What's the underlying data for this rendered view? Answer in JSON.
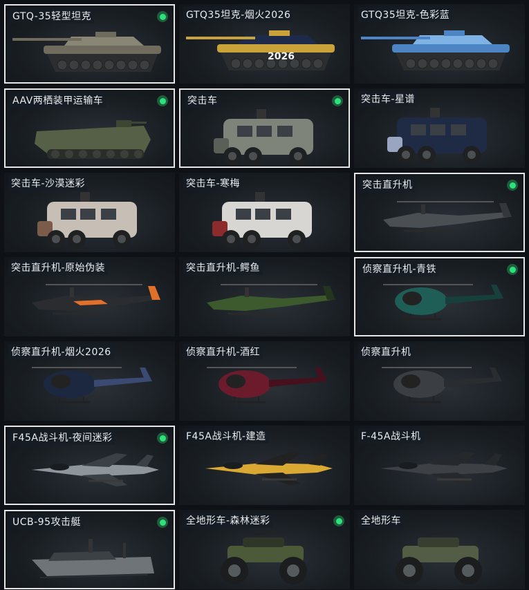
{
  "items": [
    {
      "label": "GTQ-35轻型坦克",
      "owned": true,
      "selected": true,
      "icon": "tank-icon",
      "colors": [
        "#8a8675",
        "#6f6c5e"
      ]
    },
    {
      "label": "GTQ35坦克-烟火2026",
      "owned": false,
      "selected": false,
      "icon": "tank-icon",
      "colors": [
        "#1d2a4a",
        "#c9a23a"
      ],
      "decal": "2026"
    },
    {
      "label": "GTQ35坦克-色彩蓝",
      "owned": false,
      "selected": false,
      "icon": "tank-icon",
      "colors": [
        "#7fb3e6",
        "#4d85c4"
      ]
    },
    {
      "label": "AAV两栖装甲运输车",
      "owned": true,
      "selected": true,
      "icon": "amphibious-vehicle-icon",
      "colors": [
        "#556046",
        "#3d4633"
      ]
    },
    {
      "label": "突击车",
      "owned": true,
      "selected": true,
      "icon": "armored-truck-icon",
      "colors": [
        "#7e847a",
        "#5a6057"
      ]
    },
    {
      "label": "突击车-星谱",
      "owned": false,
      "selected": false,
      "icon": "armored-truck-icon",
      "colors": [
        "#1f2b45",
        "#9aa5c2"
      ]
    },
    {
      "label": "突击车-沙漠迷彩",
      "owned": false,
      "selected": false,
      "icon": "armored-truck-icon",
      "colors": [
        "#c7bfb5",
        "#7b5b4a"
      ]
    },
    {
      "label": "突击车-寒梅",
      "owned": false,
      "selected": false,
      "icon": "armored-truck-icon",
      "colors": [
        "#d8d6d2",
        "#8c2b2b"
      ]
    },
    {
      "label": "突击直升机",
      "owned": true,
      "selected": true,
      "icon": "attack-helicopter-icon",
      "colors": [
        "#4a4f53",
        "#34383c"
      ]
    },
    {
      "label": "突击直升机-原始伪装",
      "owned": false,
      "selected": false,
      "icon": "attack-helicopter-icon",
      "colors": [
        "#2a2c30",
        "#e0702a"
      ]
    },
    {
      "label": "突击直升机-鳄鱼",
      "owned": false,
      "selected": false,
      "icon": "attack-helicopter-icon",
      "colors": [
        "#3c5a2e",
        "#23351d"
      ]
    },
    {
      "label": "侦察直升机-青铁",
      "owned": true,
      "selected": true,
      "icon": "scout-helicopter-icon",
      "colors": [
        "#1f5d57",
        "#173f3b"
      ]
    },
    {
      "label": "侦察直升机-烟火2026",
      "owned": false,
      "selected": false,
      "icon": "scout-helicopter-icon",
      "colors": [
        "#1c2740",
        "#3a4a73"
      ]
    },
    {
      "label": "侦察直升机-酒红",
      "owned": false,
      "selected": false,
      "icon": "scout-helicopter-icon",
      "colors": [
        "#6b1b2c",
        "#46111d"
      ]
    },
    {
      "label": "侦察直升机",
      "owned": false,
      "selected": false,
      "icon": "scout-helicopter-icon",
      "colors": [
        "#3b3e42",
        "#2a2d30"
      ]
    },
    {
      "label": "F45A战斗机-夜间迷彩",
      "owned": true,
      "selected": true,
      "icon": "fighter-jet-icon",
      "colors": [
        "#8e959b",
        "#3b4046"
      ]
    },
    {
      "label": "F45A战斗机-建造",
      "owned": false,
      "selected": false,
      "icon": "fighter-jet-icon",
      "colors": [
        "#d9a934",
        "#222222"
      ]
    },
    {
      "label": "F-45A战斗机",
      "owned": false,
      "selected": false,
      "icon": "fighter-jet-icon",
      "colors": [
        "#3d4146",
        "#26292c"
      ]
    },
    {
      "label": "UCB-95攻击艇",
      "owned": true,
      "selected": true,
      "icon": "attack-boat-icon",
      "colors": [
        "#6e7478",
        "#3c4145"
      ]
    },
    {
      "label": "全地形车-森林迷彩",
      "owned": true,
      "selected": false,
      "icon": "atv-icon",
      "colors": [
        "#4c5a3a",
        "#2f3627"
      ]
    },
    {
      "label": "全地形车",
      "owned": false,
      "selected": false,
      "icon": "atv-icon",
      "colors": [
        "#535d45",
        "#383f30"
      ]
    }
  ],
  "accent": "#2de27c"
}
